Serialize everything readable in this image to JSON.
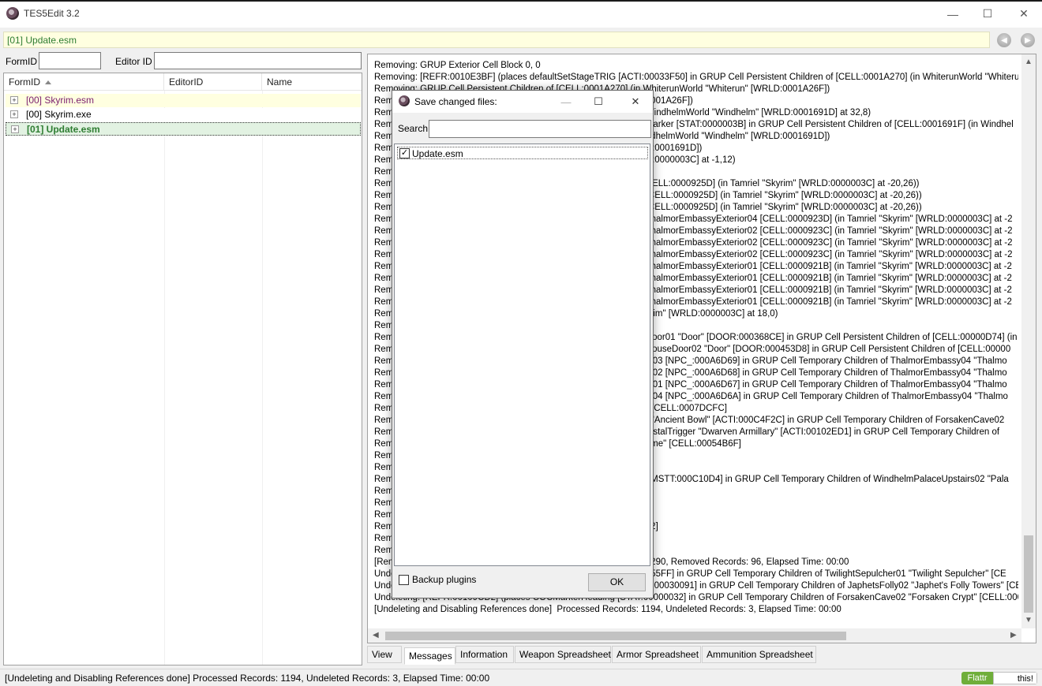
{
  "window": {
    "title": "TES5Edit 3.2",
    "minimize_glyph": "—",
    "maximize_glyph": "☐",
    "close_glyph": "✕"
  },
  "path_bar": {
    "text": "[01] Update.esm"
  },
  "nav": {
    "back_glyph": "◀",
    "forward_glyph": "▶"
  },
  "filters": {
    "formid_label": "FormID",
    "editorid_label": "Editor ID",
    "formid_value": "",
    "editorid_value": ""
  },
  "tree": {
    "columns": [
      "FormID",
      "EditorID",
      "Name"
    ],
    "rows": [
      {
        "expander": "+",
        "label": "[00] Skyrim.esm",
        "color": "#7b1f6e",
        "bg": "#ffffe0"
      },
      {
        "expander": "+",
        "label": "[00] Skyrim.exe",
        "color": "#000000",
        "bg": "#ffffff"
      },
      {
        "expander": "+",
        "label": "[01] Update.esm",
        "color": "#2e7d32",
        "bg": "#e2f2e2"
      }
    ]
  },
  "messages": [
    "Removing: GRUP Exterior Cell Block 0, 0",
    "Removing: [REFR:0010E3BF] (places defaultSetStageTRIG [ACTI:00033F50] in GRUP Cell Persistent Children of [CELL:0001A270] (in WhiterunWorld \"Whiterun",
    "Removing: GRUP Cell Persistent Children of [CELL:0001A270] (in WhiterunWorld \"Whiterun\" [WRLD:0001A26F])",
    "Rem                                                                                                    0001A26F])",
    "Rem                                                                                                    WindhelmWorld \"Windhelm\" [WRLD:0001691D] at 32,8)",
    "Rem                                                                                                    Marker [STAT:0000003B] in GRUP Cell Persistent Children of [CELL:0001691F] (in Windhel",
    "Rem                                                                                                    ndhelmWorld \"Windhelm\" [WRLD:0001691D])",
    "Rem                                                                                                    D:0001691D])",
    "Rem                                                                                                    D:0000003C] at -1,12)",
    "Rem",
    "Rem                                                                                                    CELL:0000925D] (in Tamriel \"Skyrim\" [WRLD:0000003C] at -20,26))",
    "Rem                                                                                                    [CELL:0000925D] (in Tamriel \"Skyrim\" [WRLD:0000003C] at -20,26))",
    "Rem                                                                                                    [CELL:0000925D] (in Tamriel \"Skyrim\" [WRLD:0000003C] at -20,26))",
    "Rem                                                                                                    ThalmorEmbassyExterior04 [CELL:0000923D] (in Tamriel \"Skyrim\" [WRLD:0000003C] at -2",
    "Rem                                                                                                    ThalmorEmbassyExterior02 [CELL:0000923C] (in Tamriel \"Skyrim\" [WRLD:0000003C] at -2",
    "Rem                                                                                                    ThalmorEmbassyExterior02 [CELL:0000923C] (in Tamriel \"Skyrim\" [WRLD:0000003C] at -2",
    "Rem                                                                                                    ThalmorEmbassyExterior02 [CELL:0000923C] (in Tamriel \"Skyrim\" [WRLD:0000003C] at -2",
    "Rem                                                                                                    ThalmorEmbassyExterior01 [CELL:0000921B] (in Tamriel \"Skyrim\" [WRLD:0000003C] at -2",
    "Rem                                                                                                    ThalmorEmbassyExterior01 [CELL:0000921B] (in Tamriel \"Skyrim\" [WRLD:0000003C] at -2",
    "Rem                                                                                                    ThalmorEmbassyExterior01 [CELL:0000921B] (in Tamriel \"Skyrim\" [WRLD:0000003C] at -2",
    "Rem                                                                                                    ThalmorEmbassyExterior01 [CELL:0000921B] (in Tamriel \"Skyrim\" [WRLD:0000003C] at -2",
    "Rem                                                                                                    yrim\" [WRLD:0000003C] at 18,0)",
    "Rem",
    "Rem                                                                                                    Door01 \"Door\" [DOOR:000368CE] in GRUP Cell Persistent Children of [CELL:00000D74] (in",
    "Rem                                                                                                    HouseDoor02 \"Door\" [DOOR:000453D8] in GRUP Cell Persistent Children of [CELL:00000",
    "Rem                                                                                                    ift03 [NPC_:000A6D69] in GRUP Cell Temporary Children of ThalmorEmbassy04 \"Thalmo",
    "Rem                                                                                                    ift02 [NPC_:000A6D68] in GRUP Cell Temporary Children of ThalmorEmbassy04 \"Thalmo",
    "Rem                                                                                                    ift01 [NPC_:000A6D67] in GRUP Cell Temporary Children of ThalmorEmbassy04 \"Thalmo",
    "Rem                                                                                                    ift04 [NPC_:000A6D6A] in GRUP Cell Temporary Children of ThalmorEmbassy04 \"Thalmo",
    "Rem                                                                                                    \" [CELL:0007DCFC]",
    "Rem                                                                                                    r \"Ancient Bowl\" [ACTI:000C4F2C] in GRUP Cell Temporary Children of ForsakenCave02",
    "Rem                                                                                                    rystalTrigger \"Dwarven Armillary\" [ACTI:00102ED1] in GRUP Cell Temporary Children of",
    "Rem                                                                                                    ome\" [CELL:00054B6F]",
    "Rem",
    "Rem",
    "Rem                                                                                                     [MSTT:000C10D4] in GRUP Cell Temporary Children of WindhelmPalaceUpstairs02 \"Pala",
    "Rem",
    "Rem",
    "Rem                                                                                                    )",
    "Rem                                                                                                    32]",
    "Rem",
    "Rem",
    "[Rem                                                                                                   1290, Removed Records: 96, Elapsed Time: 00:00",
    "Unde                                                                                                   455FF] in GRUP Cell Temporary Children of TwilightSepulcher01 \"Twilight Sepulcher\" [CE",
    "Undeleting: [REFR:0002BDB0] (places CommonBed01 \"Bed\" [FURN:00030091] in GRUP Cell Temporary Children of JaphetsFolly02 \"Japhet's Folly Towers\" [CE",
    "Undeleting: [REFR:00109CD2] (places COCMarkerHeading [STAT:00000032] in GRUP Cell Temporary Children of ForsakenCave02 \"Forsaken Crypt\" [CELL:000",
    "[Undeleting and Disabling References done]  Processed Records: 1194, Undeleted Records: 3, Elapsed Time: 00:00"
  ],
  "tabs": [
    "View",
    "Messages",
    "Information",
    "Weapon Spreadsheet",
    "Armor Spreadsheet",
    "Ammunition Spreadsheet"
  ],
  "active_tab": "Messages",
  "status": {
    "text": "[Undeleting and Disabling References done]  Processed Records: 1194, Undeleted Records: 3, Elapsed Time: 00:00"
  },
  "flattr": {
    "left": "Flattr",
    "right": "this!"
  },
  "dialog": {
    "title": "Save changed files:",
    "search_label": "Search",
    "search_value": "",
    "items": [
      {
        "label": "Update.esm",
        "checked": true
      }
    ],
    "backup_label": "Backup plugins",
    "backup_checked": false,
    "ok_label": "OK",
    "check_glyph": "✓"
  },
  "colors": {
    "accent_green": "#2e7d32",
    "esm_purple": "#7b1f6e",
    "path_bg": "#ffffe0"
  }
}
